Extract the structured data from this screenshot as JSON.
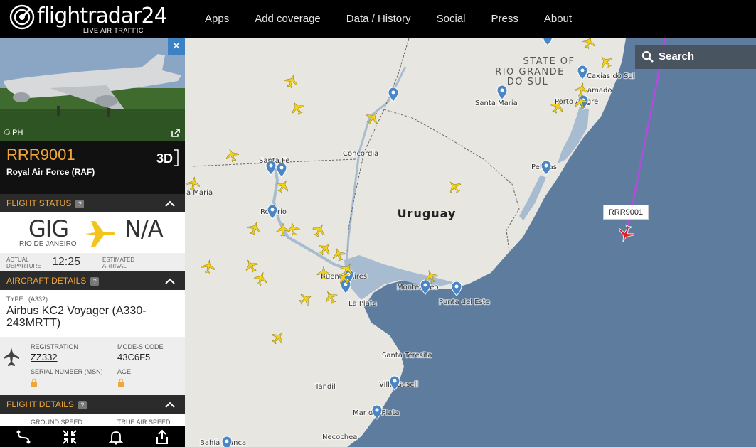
{
  "header": {
    "logo_word": "flightradar24",
    "logo_tag": "LIVE AIR TRAFFIC",
    "nav": [
      "Apps",
      "Add coverage",
      "Data / History",
      "Social",
      "Press",
      "About"
    ]
  },
  "search": {
    "label": "Search",
    "icon": "search-icon"
  },
  "map": {
    "colors": {
      "land": "#e8e6e1",
      "water": "#a7bcd0",
      "ocean": "#5e7d9e",
      "track": "#b44ae0",
      "aircraft": "#f3d21c",
      "selected_aircraft": "#d9232f",
      "pin": "#4a86c5"
    },
    "region_labels": [
      "STATE OF",
      "RIO GRANDE",
      "DO SUL"
    ],
    "country_label": "Uruguay",
    "place_labels": [
      {
        "name": "Caxias do Sul"
      },
      {
        "name": "amado"
      },
      {
        "name": "Porto Alegre"
      },
      {
        "name": "Santa Maria"
      },
      {
        "name": "Concordia"
      },
      {
        "name": "Santa Fe"
      },
      {
        "name": "a Maria"
      },
      {
        "name": "Rosario"
      },
      {
        "name": "Pelotas"
      },
      {
        "name": "Buenos Aires"
      },
      {
        "name": "La Plata"
      },
      {
        "name": "Montevideo"
      },
      {
        "name": "Punta del Este"
      },
      {
        "name": "Santa Teresita"
      },
      {
        "name": "Tandil"
      },
      {
        "name": "Villa Gesell"
      },
      {
        "name": "Mar del Plata"
      },
      {
        "name": "Necochea"
      },
      {
        "name": "Bahía Blanca"
      }
    ],
    "selected_callsign": "RRR9001"
  },
  "panel": {
    "photo_credit": "© PH",
    "callsign": "RRR9001",
    "airline": "Royal Air Force (RAF)",
    "sections": {
      "flight_status": "FLIGHT STATUS",
      "aircraft_details": "AIRCRAFT DETAILS",
      "flight_details": "FLIGHT DETAILS"
    },
    "route": {
      "origin": "GIG",
      "origin_city": "RIO DE JANEIRO",
      "destination": "N/A"
    },
    "times": {
      "actual_label": "ACTUAL",
      "departure_label": "DEPARTURE",
      "departure_value": "12:25",
      "estimated_label": "ESTIMATED",
      "arrival_label": "ARRIVAL",
      "arrival_value": "-"
    },
    "aircraft": {
      "type_label": "TYPE",
      "type_code": "(A332)",
      "type_name": "Airbus KC2 Voyager (A330-243MRTT)",
      "registration_label": "REGISTRATION",
      "registration": "ZZ332",
      "modes_label": "MODE-S CODE",
      "modes": "43C6F5",
      "serial_label": "SERIAL NUMBER (MSN)",
      "age_label": "AGE"
    },
    "flight": {
      "ground_speed_label": "GROUND SPEED",
      "true_air_speed_label": "TRUE AIR SPEED"
    }
  }
}
